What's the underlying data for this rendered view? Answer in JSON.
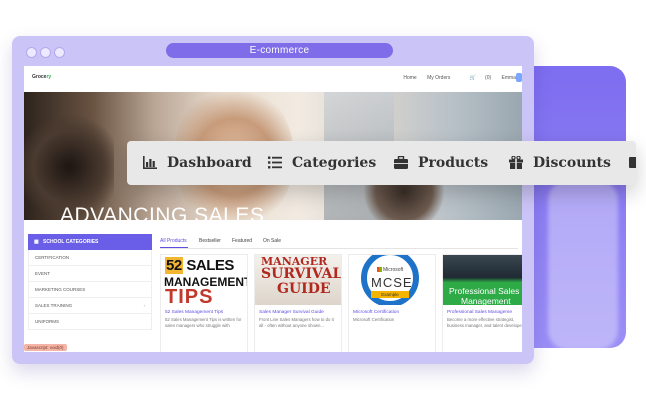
{
  "window": {
    "title": "E-commerce"
  },
  "site": {
    "logo_text": "Groce",
    "logo_accent": "ry",
    "nav": [
      "Home",
      "My Orders",
      "(0)",
      "Emma"
    ],
    "hero_text": "ADVANCING SALES"
  },
  "sidebar": {
    "title": "SCHOOL CATEGORIES",
    "items": [
      {
        "label": "CERTIFICATION"
      },
      {
        "label": "EVENT"
      },
      {
        "label": "MARKETING COURSES"
      },
      {
        "label": "SALES TRAINING"
      },
      {
        "label": "UNIFORMS"
      }
    ],
    "tag": "Javascript: void(0)"
  },
  "tabs": [
    "All Products",
    "Bestseller",
    "Featured",
    "On Sale"
  ],
  "products": [
    {
      "thumb": {
        "line1_num": "52",
        "line1_rest": " SALES",
        "line2": "MANAGEMENT",
        "line3": "TIPS"
      },
      "title": "52 Sales Management Tips",
      "desc": "52 Sales Management Tips is written for sales managers who struggle with"
    },
    {
      "thumb": {
        "line1": "MANAGER",
        "line2": "SURVIVAL",
        "line3": "GUIDE"
      },
      "title": "Sales Manager Survival Guide",
      "desc": "Front Line Sales Managers how to do it all - often without anyone shown..."
    },
    {
      "thumb": {
        "brand": "Microsoft",
        "name": "MCSE",
        "ribbon": "Example"
      },
      "title": "Microsoft Certification",
      "desc": "Microsoft Certification"
    },
    {
      "thumb": {
        "line1": "Professional Sales",
        "line2": "Management"
      },
      "title": "Professional Sales Manageme",
      "desc": "Become a more effective strategist, business manager, and talent develope."
    }
  ],
  "menu": [
    {
      "label": "Dashboard",
      "icon": "bar-chart-icon"
    },
    {
      "label": "Categories",
      "icon": "list-icon"
    },
    {
      "label": "Products",
      "icon": "briefcase-icon"
    },
    {
      "label": "Discounts",
      "icon": "gift-icon"
    }
  ],
  "colors": {
    "accent": "#6a5ee8",
    "frame": "#cbc4f6",
    "url_pill": "#7f6ce8",
    "menu_bg": "#e8e8e8"
  }
}
